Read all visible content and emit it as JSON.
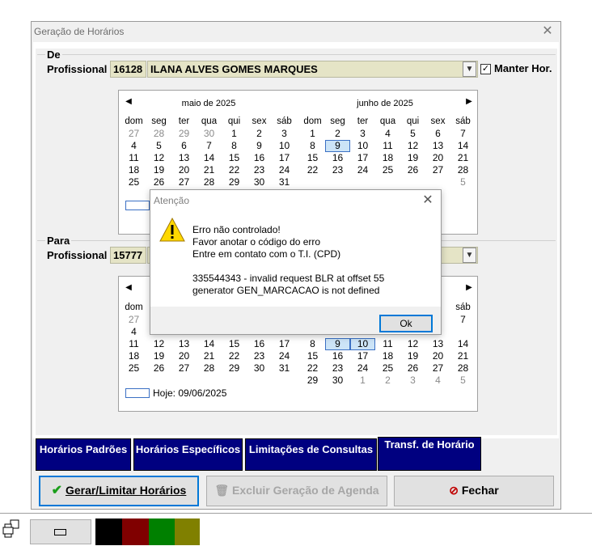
{
  "window": {
    "title": "Geração de Horários",
    "close": "✕"
  },
  "de": {
    "group_title": "De",
    "profissional_label": "Profissional",
    "code": "16128",
    "name": "ILANA ALVES GOMES MARQUES",
    "keep_label": "Manter Hor.",
    "keep_checked": "✓"
  },
  "para": {
    "group_title": "Para",
    "profissional_label": "Profissional",
    "code": "15777"
  },
  "calendar_top": {
    "month_left": "maio de 2025",
    "month_right": "junho de 2025",
    "weekdays": [
      "dom",
      "seg",
      "ter",
      "qua",
      "qui",
      "sex",
      "sáb"
    ],
    "left_days": [
      [
        "27",
        "28",
        "29",
        "30",
        "1",
        "2",
        "3"
      ],
      [
        "4",
        "5",
        "6",
        "7",
        "8",
        "9",
        "10"
      ],
      [
        "11",
        "12",
        "13",
        "14",
        "15",
        "16",
        "17"
      ],
      [
        "18",
        "19",
        "20",
        "21",
        "22",
        "23",
        "24"
      ],
      [
        "25",
        "26",
        "27",
        "28",
        "29",
        "30",
        "31"
      ]
    ],
    "right_days": [
      [
        "1",
        "2",
        "3",
        "4",
        "5",
        "6",
        "7"
      ],
      [
        "8",
        "9",
        "10",
        "11",
        "12",
        "13",
        "14"
      ],
      [
        "15",
        "16",
        "17",
        "18",
        "19",
        "20",
        "21"
      ],
      [
        "22",
        "23",
        "24",
        "25",
        "26",
        "27",
        "28"
      ]
    ],
    "right_extra": "5"
  },
  "calendar_bottom": {
    "left_partial": {
      "col_dom": [
        "dom",
        "27",
        "4",
        "11",
        "18",
        "25"
      ],
      "rows": [
        [
          "11",
          "12",
          "13",
          "14",
          "15",
          "16",
          "17"
        ],
        [
          "18",
          "19",
          "20",
          "21",
          "22",
          "23",
          "24"
        ],
        [
          "25",
          "26",
          "27",
          "28",
          "29",
          "30",
          "31"
        ]
      ]
    },
    "right_partial": {
      "sab_col": [
        "sáb",
        "7"
      ],
      "rows": [
        [
          "8",
          "9",
          "10",
          "11",
          "12",
          "13",
          "14"
        ],
        [
          "15",
          "16",
          "17",
          "18",
          "19",
          "20",
          "21"
        ],
        [
          "22",
          "23",
          "24",
          "25",
          "26",
          "27",
          "28"
        ],
        [
          "29",
          "30",
          "1",
          "2",
          "3",
          "4",
          "5"
        ]
      ]
    },
    "today_label": "Hoje: 09/06/2025"
  },
  "tabs": [
    "Horários Padrões",
    "Horários Específicos",
    "Limitações de Consultas",
    "Transf. de Horário"
  ],
  "buttons": {
    "generate": "Gerar/Limitar Horários",
    "generate_underline": "G",
    "delete": "Excluir Geração de Agenda",
    "close": "Fechar",
    "close_underline": "F"
  },
  "dialog": {
    "title": "Atenção",
    "close": "✕",
    "lines": [
      "Erro não controlado!",
      "Favor anotar o código do erro",
      "Entre em contato com o T.I. (CPD)",
      "",
      "335544343 - invalid request BLR at offset 55",
      "generator GEN_MARCACAO is not defined"
    ],
    "ok": "Ok"
  },
  "colors": {
    "tab_bg": "#000080",
    "field_bg": "#e5e4c6",
    "swatches": [
      "#000000",
      "#800000",
      "#008000",
      "#808000"
    ]
  }
}
